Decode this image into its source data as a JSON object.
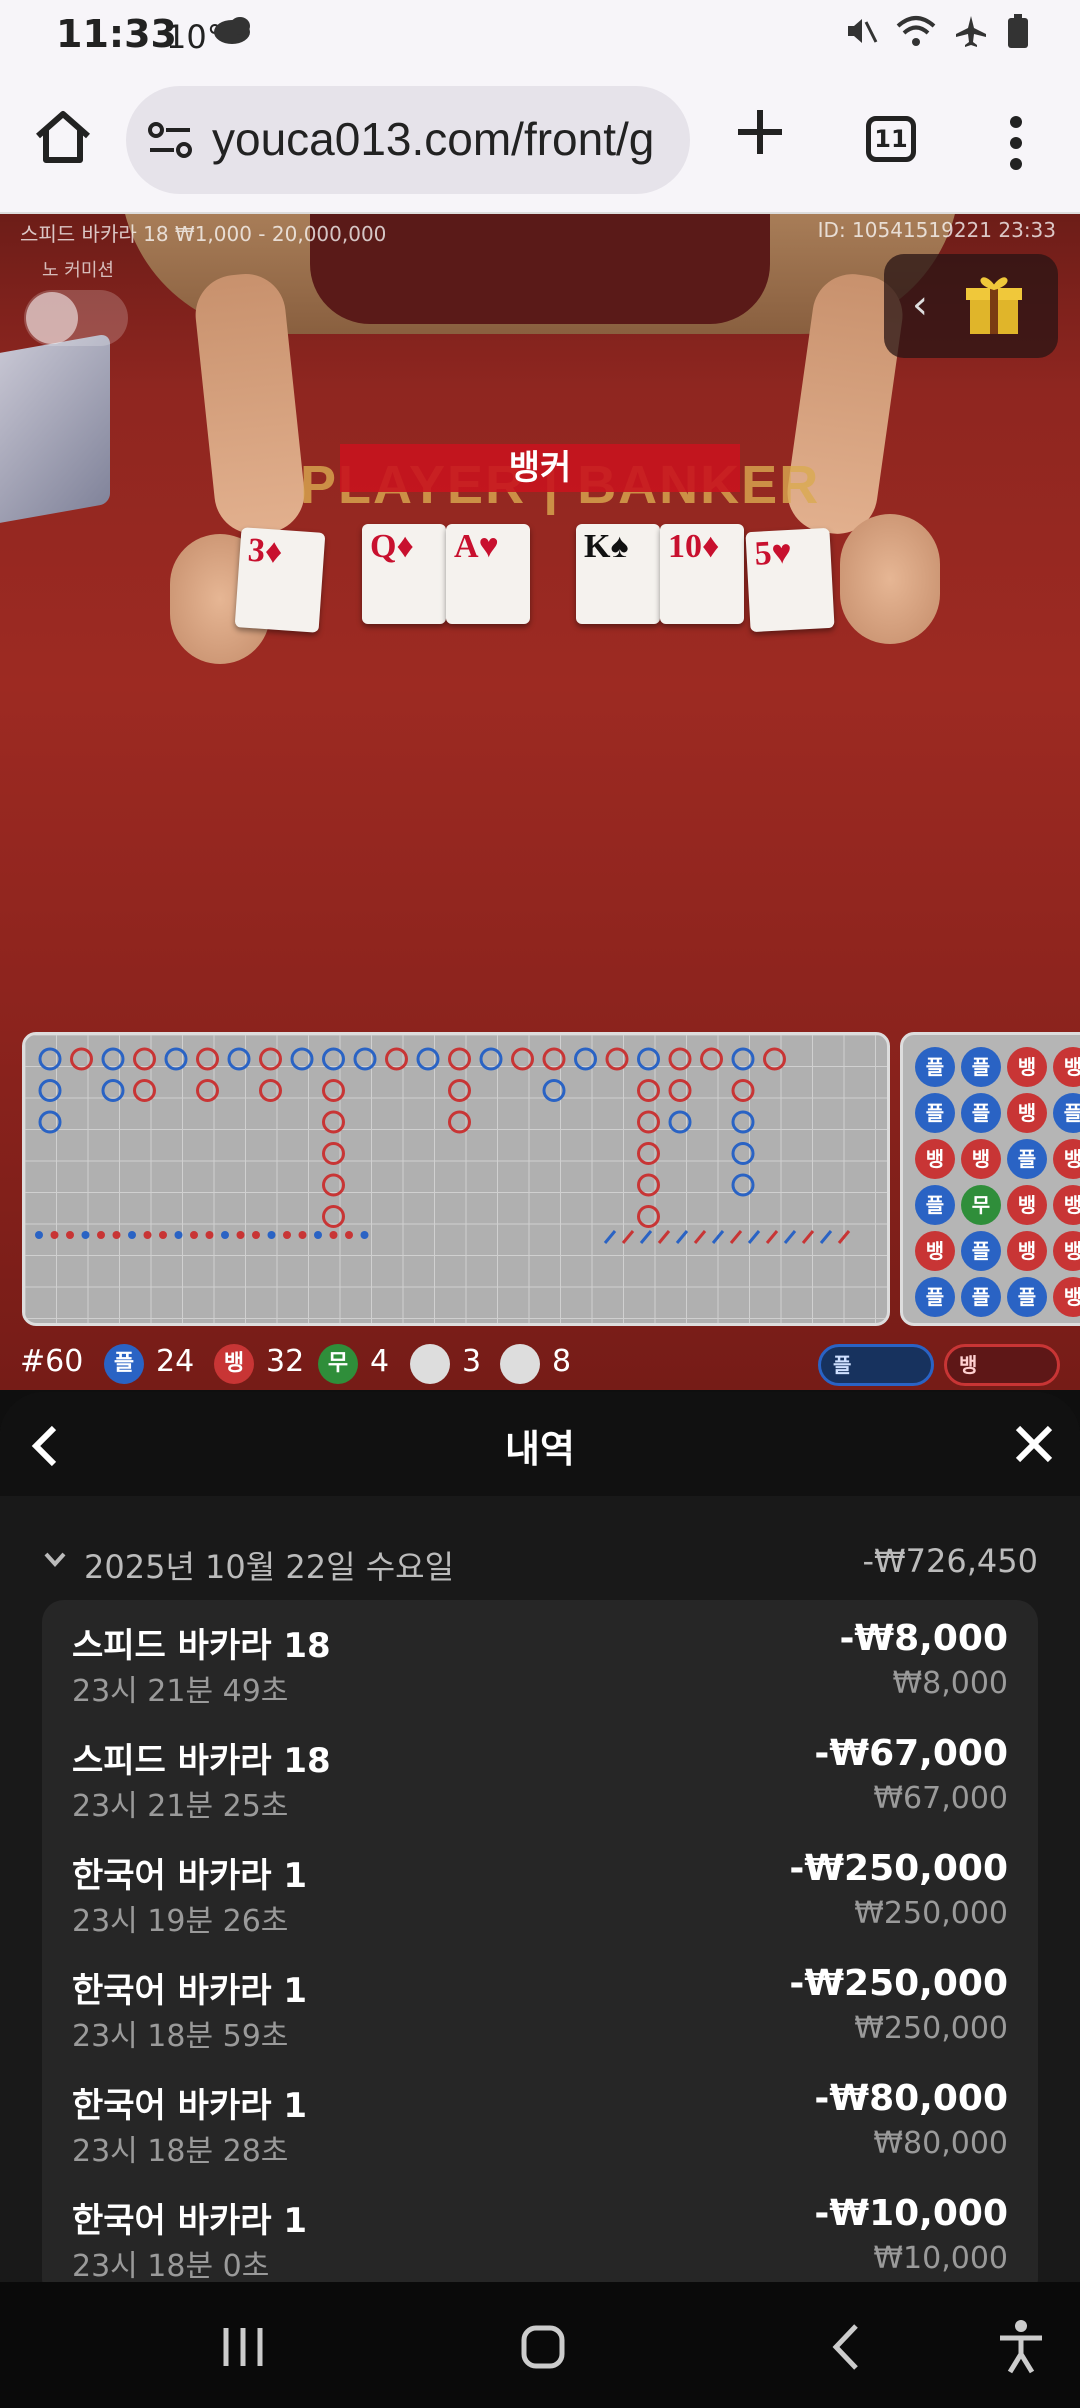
{
  "status": {
    "time": "11:33",
    "temp": "10°"
  },
  "browser": {
    "url": "youca013.com/front/g",
    "tab_count": "11"
  },
  "game": {
    "table_info": "스피드 바카라 18 ₩1,000 - 20,000,000",
    "mode": "노 커미션",
    "round_id": "ID: 10541519221 23:33",
    "result_banner": "뱅커",
    "table_text": "PLAYER | BANKER",
    "player_cards": [
      {
        "rank": "3",
        "suit": "♦",
        "color": "red"
      },
      {
        "rank": "Q",
        "suit": "♦",
        "color": "red"
      },
      {
        "rank": "A",
        "suit": "♥",
        "color": "red"
      }
    ],
    "banker_cards": [
      {
        "rank": "K",
        "suit": "♠",
        "color": "black"
      },
      {
        "rank": "10",
        "suit": "♦",
        "color": "red"
      },
      {
        "rank": "5",
        "suit": "♥",
        "color": "red"
      }
    ]
  },
  "beads": {
    "rows": [
      [
        "플",
        "플",
        "뱅",
        "뱅"
      ],
      [
        "플",
        "플",
        "뱅",
        "플"
      ],
      [
        "뱅",
        "뱅",
        "플",
        "뱅"
      ],
      [
        "플",
        "무",
        "뱅",
        "뱅"
      ],
      [
        "뱅",
        "플",
        "뱅",
        "뱅"
      ],
      [
        "플",
        "플",
        "플",
        "뱅"
      ]
    ]
  },
  "stats": {
    "round": "#60",
    "player_label": "플",
    "player_count": "24",
    "banker_label": "뱅",
    "banker_count": "32",
    "tie_label": "무",
    "tie_count": "4",
    "ppair_count": "3",
    "bpair_count": "8",
    "predict_player": "플",
    "predict_banker": "뱅"
  },
  "history": {
    "title": "내역",
    "date_label": "2025년 10월 22일 수요일",
    "date_total": "-₩726,450",
    "items": [
      {
        "name": "스피드 바카라 18",
        "time": "23시 21분 49초",
        "amount": "-₩8,000",
        "bet": "₩8,000"
      },
      {
        "name": "스피드 바카라 18",
        "time": "23시 21분 25초",
        "amount": "-₩67,000",
        "bet": "₩67,000"
      },
      {
        "name": "한국어 바카라 1",
        "time": "23시 19분 26초",
        "amount": "-₩250,000",
        "bet": "₩250,000"
      },
      {
        "name": "한국어 바카라 1",
        "time": "23시 18분 59초",
        "amount": "-₩250,000",
        "bet": "₩250,000"
      },
      {
        "name": "한국어 바카라 1",
        "time": "23시 18분 28초",
        "amount": "-₩80,000",
        "bet": "₩80,000"
      },
      {
        "name": "한국어 바카라 1",
        "time": "23시 18분 0초",
        "amount": "-₩10,000",
        "bet": "₩10,000"
      }
    ]
  },
  "colors": {
    "player": "#2a63c4",
    "banker": "#c83535",
    "tie": "#2f8e3a",
    "sheet_bg": "#191919",
    "felt": "#9d2a22"
  }
}
